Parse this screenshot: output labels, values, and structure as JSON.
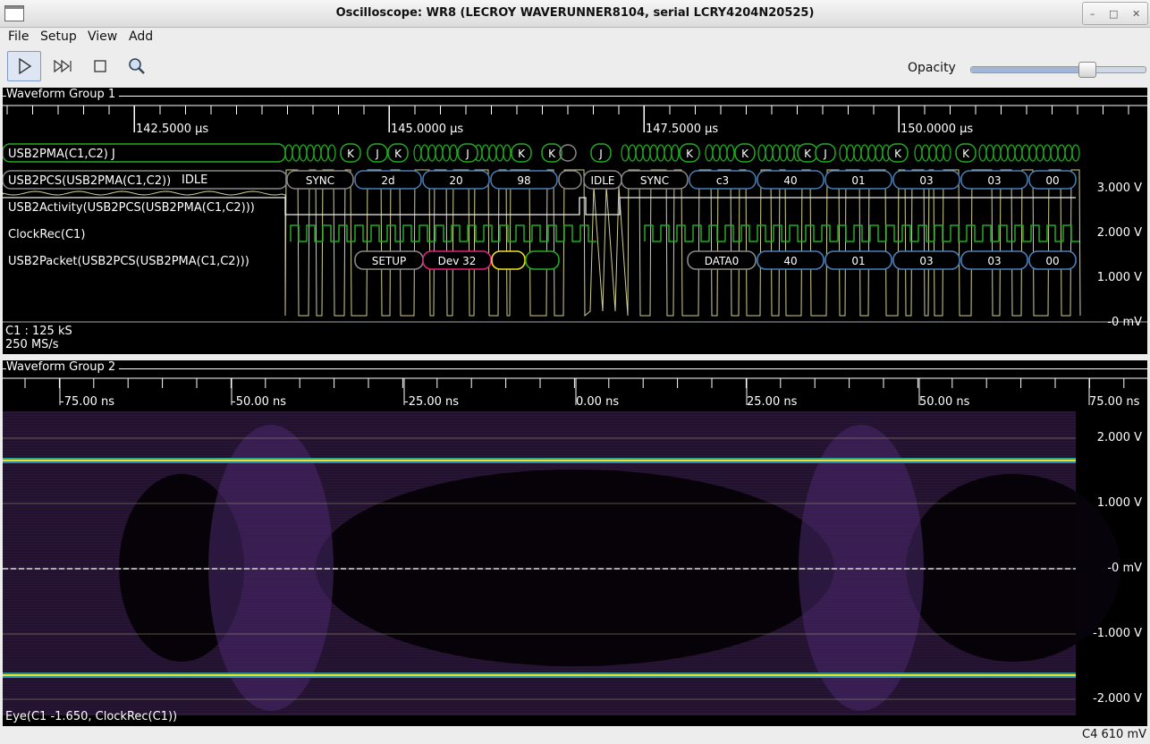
{
  "window": {
    "title": "Oscilloscope: WR8 (LECROY WAVERUNNER8104, serial LCRY4204N20525)"
  },
  "menu": [
    "File",
    "Setup",
    "View",
    "Add"
  ],
  "toolbar": {
    "buttons": [
      {
        "name": "run-button",
        "icon": "play-icon"
      },
      {
        "name": "single-step-button",
        "icon": "skip-forward-icon"
      },
      {
        "name": "stop-button",
        "icon": "stop-icon"
      },
      {
        "name": "search-button",
        "icon": "search-icon"
      }
    ],
    "opacity_label": "Opacity",
    "opacity_value": 0.66
  },
  "group1": {
    "title": "Waveform Group 1",
    "timeline": [
      "142.5000 µs",
      "145.0000 µs",
      "147.5000 µs",
      "150.0000 µs"
    ],
    "traces": [
      "USB2PMA(C1,C2) J",
      "USB2PCS(USB2PMA(C1,C2))",
      "USB2Activity(USB2PCS(USB2PMA(C1,C2)))",
      "ClockRec(C1)",
      "USB2Packet(USB2PCS(USB2PMA(C1,C2)))"
    ],
    "pma_symbols": [
      "K",
      "J",
      "K",
      "J",
      "K",
      "K",
      "J",
      "K",
      "K",
      "K",
      "J",
      "K",
      "K"
    ],
    "pcs_idle": "IDLE",
    "pcs_symbols": [
      "SYNC",
      "2d",
      "20",
      "98",
      "IDLE",
      "SYNC",
      "c3",
      "40",
      "01",
      "03",
      "03",
      "00"
    ],
    "packet_symbols": [
      "SETUP",
      "Dev 32",
      "DATA0",
      "40",
      "01",
      "03",
      "03",
      "00"
    ],
    "voltage_labels": [
      "3.000 V",
      "2.000 V",
      "1.000 V",
      "-0 mV"
    ],
    "info": [
      "C1 : 125 kS",
      "250 MS/s"
    ]
  },
  "group2": {
    "title": "Waveform Group 2",
    "timeline": [
      "-75.00 ns",
      "-50.00 ns",
      "-25.00 ns",
      "0.00 ns",
      "25.00 ns",
      "50.00 ns",
      "75.00 ns"
    ],
    "voltage_labels": [
      "2.000 V",
      "1.000 V",
      "-0 mV",
      "-1.000 V",
      "-2.000 V"
    ],
    "trace_label": "Eye(C1 -1.650, ClockRec(C1))"
  },
  "status": {
    "right": "C4 610 mV"
  },
  "colors": {
    "pma": "#22aa22",
    "pcs": "#4a7fb8",
    "gray": "#888888",
    "pink": "#e0207a",
    "yellow": "#f0e020",
    "analog": "#e8e6a0",
    "eye_bg": "#2a1638"
  }
}
